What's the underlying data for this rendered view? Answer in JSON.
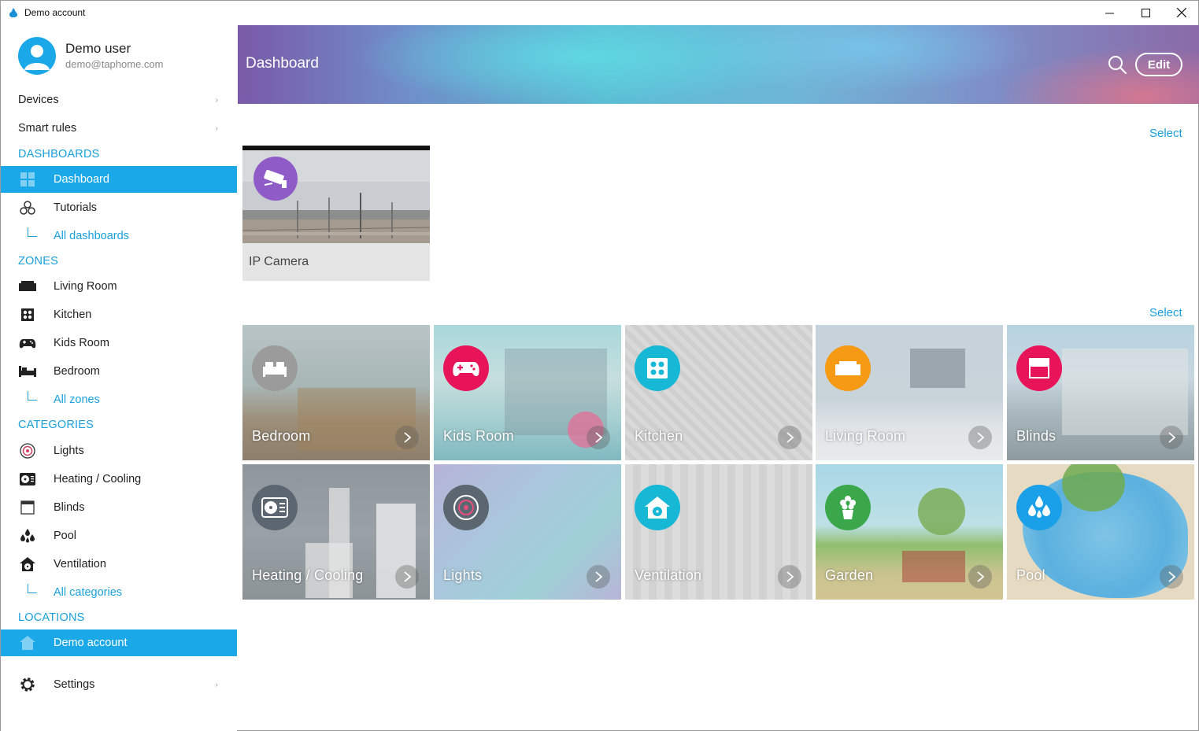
{
  "window": {
    "title": "Demo account",
    "minimize": "—",
    "maximize": "☐",
    "close": "✕"
  },
  "profile": {
    "name": "Demo user",
    "email": "demo@taphome.com"
  },
  "nav": {
    "devices": "Devices",
    "smart_rules": "Smart rules",
    "dashboards_header": "DASHBOARDS",
    "dashboards": [
      {
        "label": "Dashboard",
        "icon": "dashboard-grid-icon",
        "active": true
      },
      {
        "label": "Tutorials",
        "icon": "tutorials-icon",
        "active": false
      }
    ],
    "all_dashboards": "All dashboards",
    "zones_header": "ZONES",
    "zones": [
      {
        "label": "Living Room",
        "icon": "sofa-icon"
      },
      {
        "label": "Kitchen",
        "icon": "stove-icon"
      },
      {
        "label": "Kids Room",
        "icon": "gamepad-icon"
      },
      {
        "label": "Bedroom",
        "icon": "bed-icon"
      }
    ],
    "all_zones": "All zones",
    "categories_header": "CATEGORIES",
    "categories": [
      {
        "label": "Lights",
        "icon": "light-icon"
      },
      {
        "label": "Heating / Cooling",
        "icon": "hvac-icon"
      },
      {
        "label": "Blinds",
        "icon": "blinds-icon"
      },
      {
        "label": "Pool",
        "icon": "pool-drops-icon"
      },
      {
        "label": "Ventilation",
        "icon": "ventilation-icon"
      }
    ],
    "all_categories": "All categories",
    "locations_header": "LOCATIONS",
    "location": "Demo account",
    "settings": "Settings"
  },
  "header": {
    "title": "Dashboard",
    "edit_label": "Edit"
  },
  "sections": {
    "select_label_1": "Select",
    "select_label_2": "Select"
  },
  "camera": {
    "label": "IP Camera"
  },
  "tiles": [
    {
      "label": "Bedroom",
      "icon": "bed-icon",
      "color": "#9b9b9b"
    },
    {
      "label": "Kids Room",
      "icon": "gamepad-icon",
      "color": "#e8145a"
    },
    {
      "label": "Kitchen",
      "icon": "stove-icon",
      "color": "#17b8d6"
    },
    {
      "label": "Living Room",
      "icon": "sofa-icon",
      "color": "#f59a12"
    },
    {
      "label": "Blinds",
      "icon": "blinds-icon",
      "color": "#e8145a"
    },
    {
      "label": "Heating / Cooling",
      "icon": "hvac-icon",
      "color": "#5b6670"
    },
    {
      "label": "Lights",
      "icon": "light-icon",
      "color": "#5b6670"
    },
    {
      "label": "Ventilation",
      "icon": "ventilation-icon",
      "color": "#17b8d6"
    },
    {
      "label": "Garden",
      "icon": "flower-icon",
      "color": "#3aa84a"
    },
    {
      "label": "Pool",
      "icon": "pool-drops-icon",
      "color": "#1aa0e8"
    }
  ]
}
